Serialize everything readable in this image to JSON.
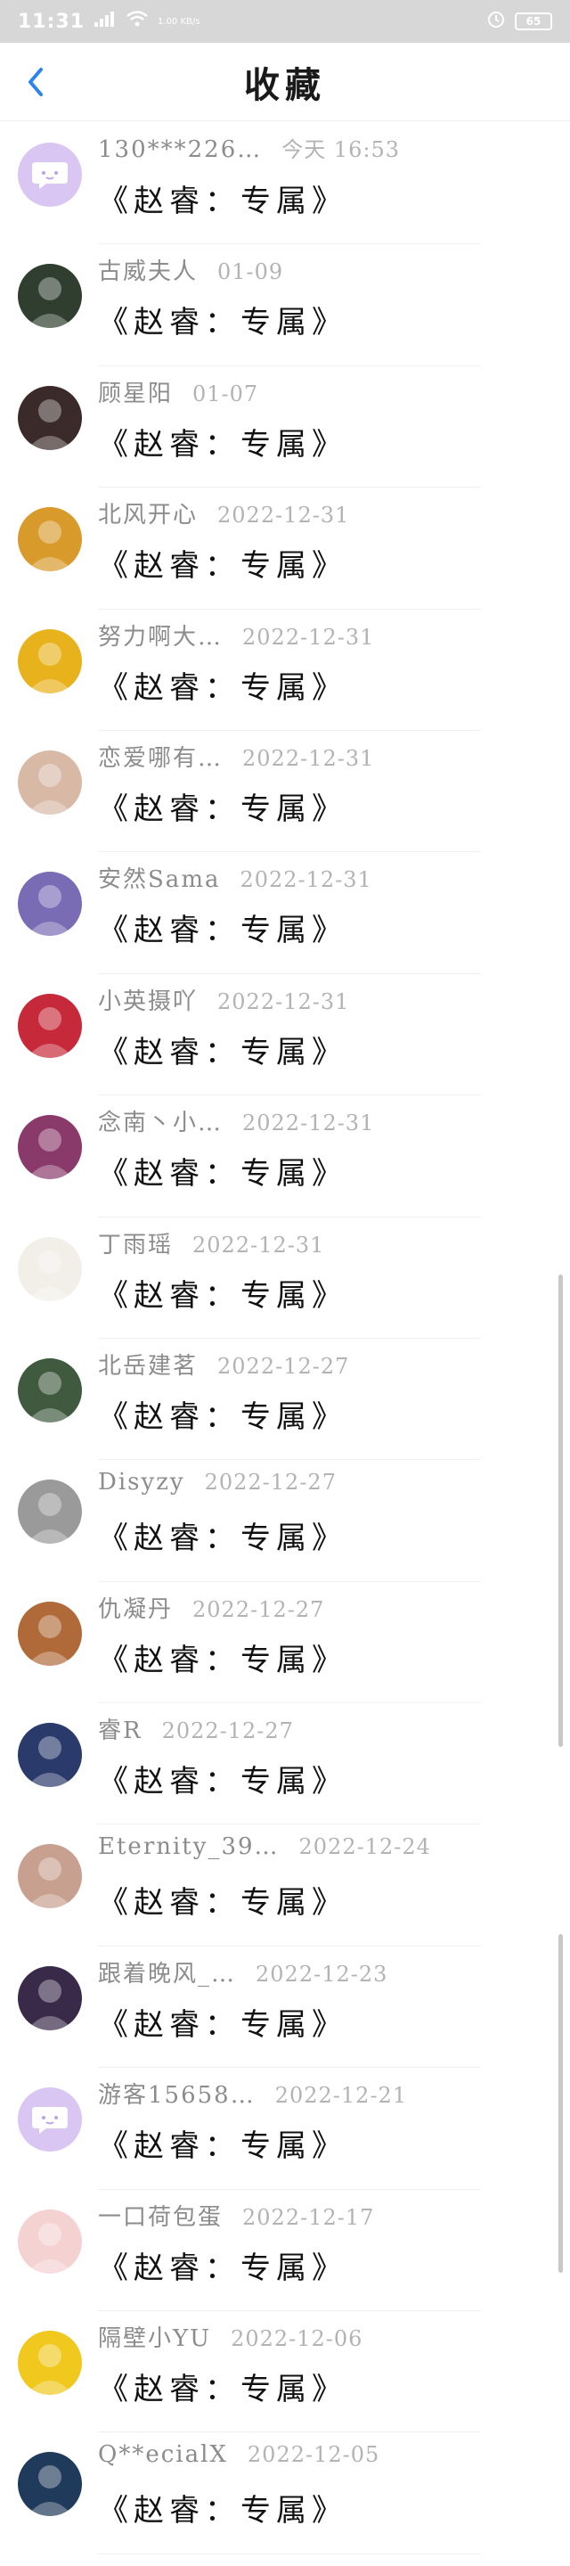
{
  "status_bar": {
    "time": "11:31",
    "net_speed": "1.00 KB/s",
    "battery": "65",
    "icons": [
      "signal-icon",
      "wifi-icon",
      "alarm-icon",
      "battery-icon"
    ]
  },
  "header": {
    "title": "收藏",
    "back_icon": "chevron-left-icon"
  },
  "colors": {
    "accent": "#2a84f0",
    "status_bar_bg": "#d7d7d7",
    "divider": "#f0f0f0"
  },
  "items": [
    {
      "username": "130***226…",
      "time": "今天 16:53",
      "message": "《赵睿：专属》",
      "avatar_color": "#d9c6f3",
      "avatar_icon": "default-chat-avatar-icon"
    },
    {
      "username": "古威夫人",
      "time": "01-09",
      "message": "《赵睿：专属》",
      "avatar_color": "#2f3e2f",
      "avatar_icon": "photo-avatar"
    },
    {
      "username": "顾星阳",
      "time": "01-07",
      "message": "《赵睿：专属》",
      "avatar_color": "#3b2a2a",
      "avatar_icon": "photo-avatar"
    },
    {
      "username": "北风开心",
      "time": "2022-12-31",
      "message": "《赵睿：专属》",
      "avatar_color": "#d89a2a",
      "avatar_icon": "photo-avatar"
    },
    {
      "username": "努力啊大…",
      "time": "2022-12-31",
      "message": "《赵睿：专属》",
      "avatar_color": "#e8b21c",
      "avatar_icon": "photo-avatar"
    },
    {
      "username": "恋爱哪有…",
      "time": "2022-12-31",
      "message": "《赵睿：专属》",
      "avatar_color": "#d8b9a6",
      "avatar_icon": "photo-avatar"
    },
    {
      "username": "安然Sama",
      "time": "2022-12-31",
      "message": "《赵睿：专属》",
      "avatar_color": "#7a6bb5",
      "avatar_icon": "photo-avatar"
    },
    {
      "username": "小英摄吖",
      "time": "2022-12-31",
      "message": "《赵睿：专属》",
      "avatar_color": "#c62a3a",
      "avatar_icon": "photo-avatar"
    },
    {
      "username": "念南丶小…",
      "time": "2022-12-31",
      "message": "《赵睿：专属》",
      "avatar_color": "#8a3a6a",
      "avatar_icon": "photo-avatar"
    },
    {
      "username": "丁雨瑶",
      "time": "2022-12-31",
      "message": "《赵睿：专属》",
      "avatar_color": "#f2efe8",
      "avatar_icon": "photo-avatar"
    },
    {
      "username": "北岳建茗",
      "time": "2022-12-27",
      "message": "《赵睿：专属》",
      "avatar_color": "#3f5a3f",
      "avatar_icon": "photo-avatar"
    },
    {
      "username": "Disyzy",
      "time": "2022-12-27",
      "message": "《赵睿：专属》",
      "avatar_color": "#9a9a9a",
      "avatar_icon": "photo-avatar"
    },
    {
      "username": "仇凝丹",
      "time": "2022-12-27",
      "message": "《赵睿：专属》",
      "avatar_color": "#b06a3a",
      "avatar_icon": "photo-avatar"
    },
    {
      "username": "睿R",
      "time": "2022-12-27",
      "message": "《赵睿：专属》",
      "avatar_color": "#2a3a6a",
      "avatar_icon": "photo-avatar"
    },
    {
      "username": "Eternity_39…",
      "time": "2022-12-24",
      "message": "《赵睿：专属》",
      "avatar_color": "#c8a090",
      "avatar_icon": "photo-avatar"
    },
    {
      "username": "跟着晚风_…",
      "time": "2022-12-23",
      "message": "《赵睿：专属》",
      "avatar_color": "#3a2a4a",
      "avatar_icon": "photo-avatar"
    },
    {
      "username": "游客15658…",
      "time": "2022-12-21",
      "message": "《赵睿：专属》",
      "avatar_color": "#d9c6f3",
      "avatar_icon": "default-chat-avatar-icon"
    },
    {
      "username": "一口荷包蛋",
      "time": "2022-12-17",
      "message": "《赵睿：专属》",
      "avatar_color": "#f5d2d2",
      "avatar_icon": "photo-avatar"
    },
    {
      "username": "隔壁小YU",
      "time": "2022-12-06",
      "message": "《赵睿：专属》",
      "avatar_color": "#f0c81e",
      "avatar_icon": "photo-avatar"
    },
    {
      "username": "Q**ecialX",
      "time": "2022-12-05",
      "message": "《赵睿：专属》",
      "avatar_color": "#1f3a5a",
      "avatar_icon": "photo-avatar"
    }
  ]
}
